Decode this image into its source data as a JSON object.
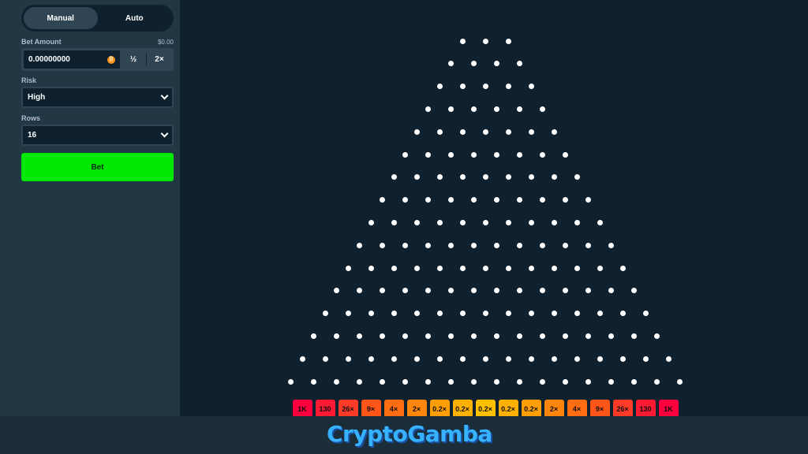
{
  "mode_toggle": {
    "manual": "Manual",
    "auto": "Auto",
    "active": "Manual"
  },
  "bet_amount": {
    "label": "Bet Amount",
    "usd_value": "$0.00",
    "value": "0.00000000",
    "half_label": "½",
    "double_label": "2×",
    "coin_icon": "bitcoin-icon"
  },
  "risk": {
    "label": "Risk",
    "value": "High"
  },
  "rows": {
    "label": "Rows",
    "value": "16"
  },
  "bet_button": {
    "label": "Bet"
  },
  "board": {
    "peg_rows": 16,
    "first_row_pegs": 3,
    "multipliers": [
      "1K",
      "130",
      "26×",
      "9×",
      "4×",
      "2×",
      "0.2×",
      "0.2×",
      "0.2×",
      "0.2×",
      "0.2×",
      "2×",
      "4×",
      "9×",
      "26×",
      "130",
      "1K"
    ]
  },
  "watermark": "CryptoGamba",
  "colors": {
    "background": "#0f212e",
    "sidebar": "#213743",
    "bet_button": "#00e701",
    "bucket_red": "#ff003f",
    "bucket_yellow": "#ffc000"
  }
}
